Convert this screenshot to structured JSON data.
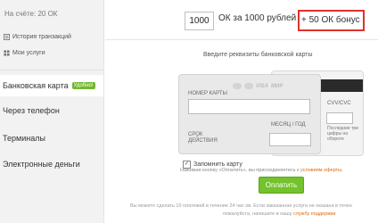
{
  "sidebar": {
    "balance": "На счёте: 20 ОК",
    "links": [
      {
        "label": "История транзакций",
        "icon": "history-icon"
      },
      {
        "label": "Мои услуги",
        "icon": "services-icon"
      }
    ],
    "methods": [
      {
        "label": "Банковская карта",
        "badge": "Удобно!",
        "active": true
      },
      {
        "label": "Через телефон"
      },
      {
        "label": "Терминалы"
      },
      {
        "label": "Электронные деньги"
      }
    ]
  },
  "purchase": {
    "amount": "1000",
    "price_text": "ОК за 1000 рублей",
    "bonus_text": "+ 50 ОК бонус",
    "bonus_border_color": "#e0322c"
  },
  "card_form": {
    "title": "Введите реквизиты банковской карты",
    "logos": [
      "VISA",
      "МИР"
    ],
    "number_label": "НОМЕР КАРТЫ",
    "expiry_label": "СРОК ДЕЙСТВИЯ",
    "expiry_month_label": "МЕСЯЦ / ГОД",
    "cvv_label": "CVV/CVC",
    "cvv_note": "Последние три цифры на обороте",
    "remember_label": "Запомнить карту",
    "remember_checked": true,
    "terms_text": "Нажимая кнопку «Оплатить», вы присоединяетесь к",
    "terms_link": "условиям оферты.",
    "pay_button": "Оплатить",
    "pay_color": "#74c22c"
  },
  "footer": {
    "line1": "Вы можете сделать 10 платежей в течение 24 час ов. Если заказанная услуга не оказана в течен",
    "line2": "пожалуйста, напишите в нашу",
    "support_link": "службу поддержки"
  }
}
